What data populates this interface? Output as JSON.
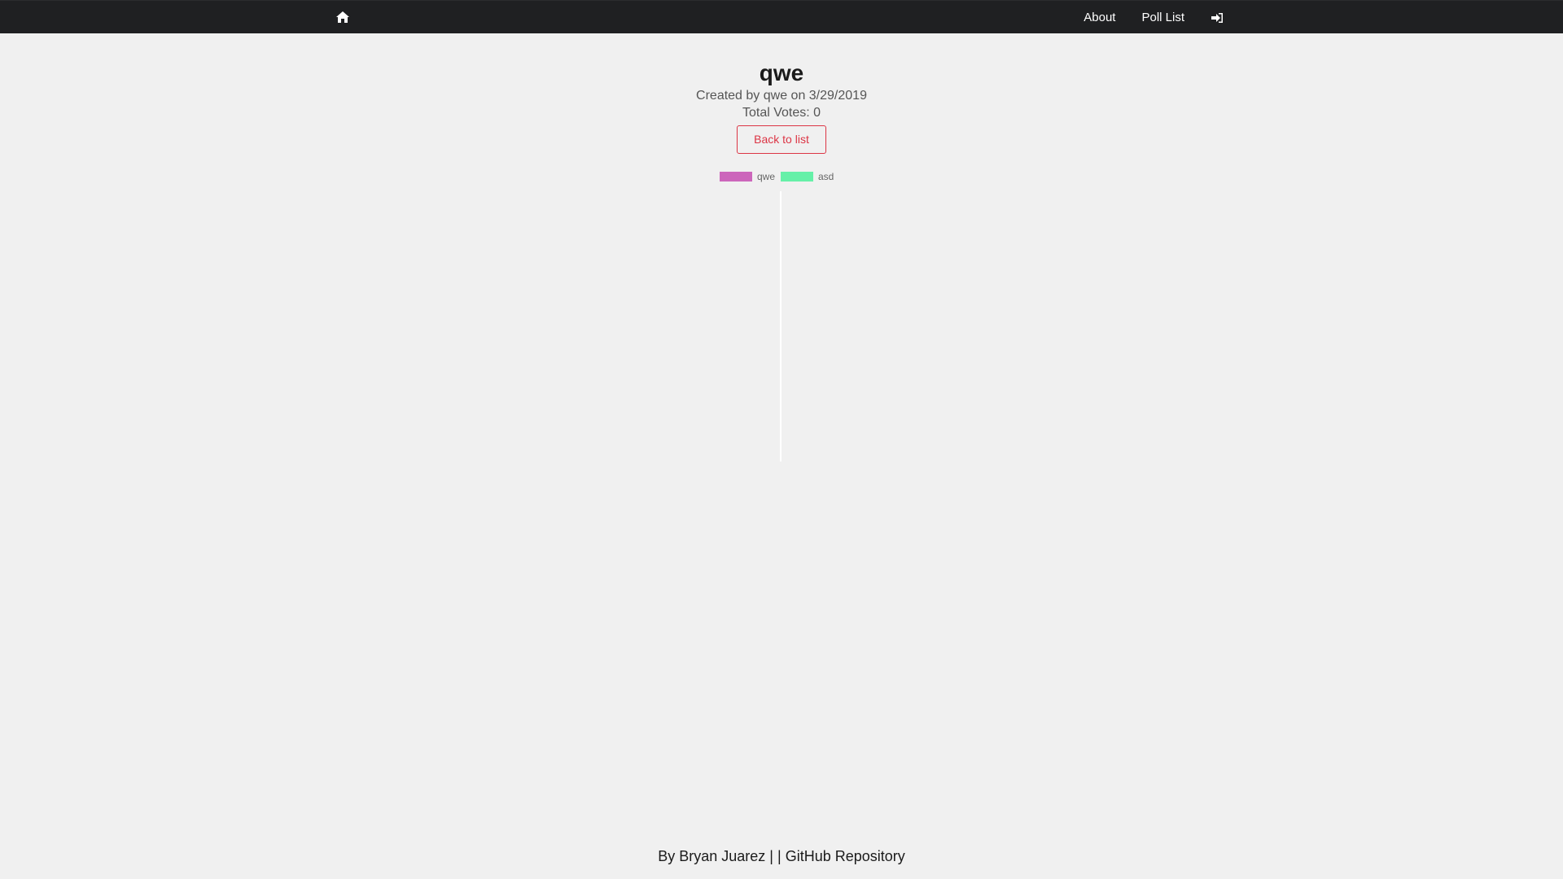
{
  "navbar": {
    "home_icon": "home-icon",
    "links": [
      {
        "label": "About"
      },
      {
        "label": "Poll List"
      }
    ],
    "signin_icon": "sign-in-icon"
  },
  "poll": {
    "title": "qwe",
    "created_text": "Created by qwe on 3/29/2019",
    "total_votes_text": "Total Votes: 0",
    "back_label": "Back to list"
  },
  "chart_data": {
    "type": "bar",
    "categories": [
      "qwe",
      "asd"
    ],
    "values": [
      0,
      0
    ],
    "colors": [
      "#cc66bb",
      "#66f0a8"
    ],
    "legend": "top-center"
  },
  "footer": {
    "author_text": "By Bryan Juarez |",
    "separator": "|",
    "repo_label": "GitHub Repository"
  }
}
